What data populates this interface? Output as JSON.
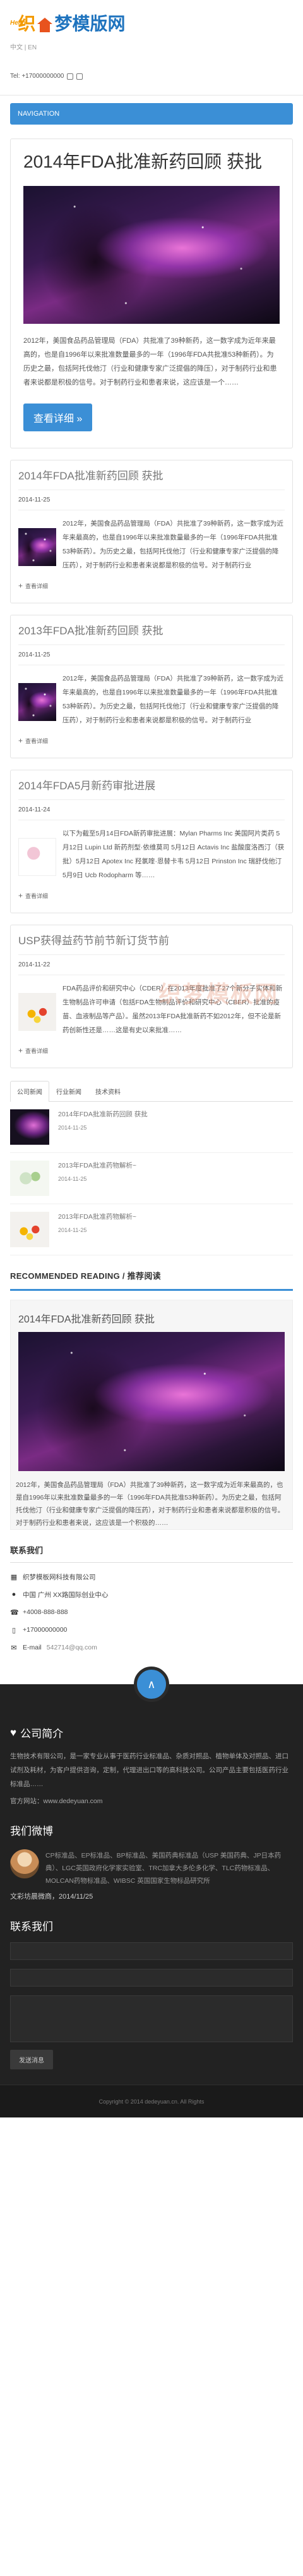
{
  "header": {
    "logo_hello": "Hello",
    "logo_part1": "织",
    "logo_part2": "梦模版网",
    "lang": "中文 | EN",
    "phone": "Tel: +17000000000"
  },
  "nav": {
    "label": "NAVIGATION"
  },
  "featured": {
    "title": "2014年FDA批准新药回顾 获批",
    "excerpt": "2012年，美国食品药品管理局（FDA）共批准了39种新药，这一数字成为近年来最高的，也是自1996年以来批准数量最多的一年（1996年FDA共批准53种新药）。为历史之最，包括阿托伐他汀（行业和健康专家广泛提倡的降压），对于制药行业和患者来说都是积极的信号。对于制药行业和患者来说，这应该是一个……",
    "button": "查看详细 »"
  },
  "posts": [
    {
      "title": "2014年FDA批准新药回顾 获批",
      "date": "2014-11-25",
      "excerpt": "2012年，美国食品药品管理局（FDA）共批准了39种新药，这一数字成为近年来最高的，也是自1996年以来批准数量最多的一年（1996年FDA共批准53种新药）。为历史之最，包括阿托伐他汀（行业和健康专家广泛提倡的降压药），对于制药行业和患者来说都是积极的信号。对于制药行业",
      "read": "查看详细"
    },
    {
      "title": "2013年FDA批准新药回顾 获批",
      "date": "2014-11-25",
      "excerpt": "2012年，美国食品药品管理局（FDA）共批准了39种新药，这一数字成为近年来最高的，也是自1996年以来批准数量最多的一年（1996年FDA共批准53种新药）。为历史之最，包括阿托伐他汀（行业和健康专家广泛提倡的降压药），对于制药行业和患者来说都是积极的信号。对于制药行业",
      "read": "查看详细"
    },
    {
      "title": "2014年FDA5月新药审批进展",
      "date": "2014-11-24",
      "excerpt": "以下为截至5月14日FDA新药审批进展：Mylan Pharms Inc 美国阿片类药 5月12日 Lupin Ltd 新药剂型·依维莫司 5月12日 Actavis Inc 盐酸度洛西汀（获批）5月12日 Apotex Inc 羟氯喹·恩替卡韦 5月12日 Prinston Inc 瑞舒伐他汀 5月9日 Ucb Rodopharm 等……",
      "read": "查看详细"
    },
    {
      "title": "USP获得益药节前节新订货节前",
      "date": "2014-11-22",
      "excerpt": "FDA药品评价和研究中心（CDER）在2013年度批准了27个新分子实体和新生物制品许可申请（包括FDA生物制品评价和研究中心（CBER）批准的疫苗、血液制品等产品）。虽然2013年FDA批准新药不如2012年，但不论是新药创新性还是……这是有史以来批准……",
      "read": "查看详细"
    }
  ],
  "watermark": "织梦模板网",
  "tabs": {
    "labels": [
      "公司新闻",
      "行业新闻",
      "技术资料"
    ],
    "items": [
      {
        "title": "2014年FDA批准新药回顾 获批",
        "date": "2014-11-25"
      },
      {
        "title": "2013年FDA批准药物解析~",
        "date": "2014-11-25"
      },
      {
        "title": "2013年FDA批准药物解析~",
        "date": "2014-11-25"
      }
    ]
  },
  "recommended": {
    "heading": "RECOMMENDED READING / 推荐阅读",
    "title": "2014年FDA批准新药回顾 获批",
    "excerpt": "2012年，美国食品药品管理局（FDA）共批准了39种新药，这一数字成为近年来最高的，也是自1996年以来批准数量最多的一年（1996年FDA共批准53种新药）。为历史之最，包括阿托伐他汀（行业和健康专家广泛提倡的降压药），对于制药行业和患者来说都是积极的信号。对于制药行业和患者来说，这应该是一个积极的……"
  },
  "contact": {
    "heading": "联系我们",
    "company": "织梦模板网科技有限公司",
    "address": "中国 广州 XX路国际创业中心",
    "tel1": "+4008-888-888",
    "tel2": "+17000000000",
    "email_label": "E-mail",
    "email": "542714@qq.com"
  },
  "footer": {
    "totop": "∧",
    "about_heading": "公司简介",
    "about_text": "生物技术有限公司，是一家专业从事于医药行业标准品、杂质对照品、植物单体及对照品、进口试剂及耗材，为客户提供咨询，定制，代理进出口等的高科技公司。公司产品主要包括医药行业标准品……",
    "site_label": "官方网站：",
    "site": "www.dedeyuan.com",
    "weibo_heading": "我们微博",
    "weibo_text": "CP标准品、EP标准品、BP标准品、美国药典标准品（USP 美国药典、JP日本药典）、LGC英国政府化学家实验室、TRC加拿大多伦多化学、TLC药物标准品、MOLCAN药物标准品、WIBSC 英国国家生物标品研究所",
    "weibo_name": "文彩坊晨微商，2014/11/25",
    "form_heading": "联系我们",
    "submit": "发送消息",
    "copyright": "Copyright © 2014 dedeyuan.cn. All Rights"
  }
}
